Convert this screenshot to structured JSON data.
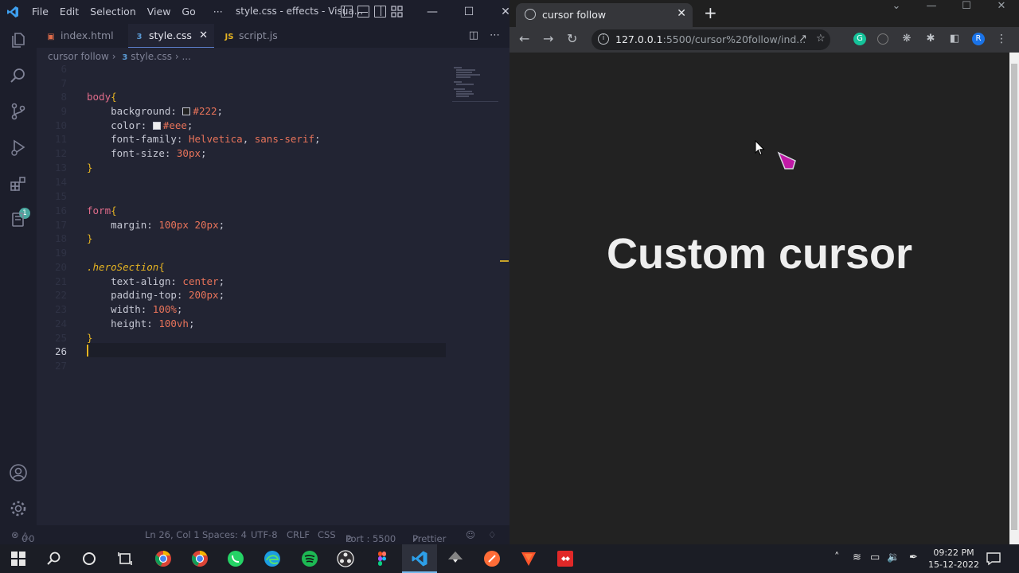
{
  "vscode": {
    "menu": [
      "File",
      "Edit",
      "Selection",
      "View",
      "Go",
      "···"
    ],
    "window_title": "style.css - effects - Visua...",
    "tabs": [
      {
        "label": "index.html",
        "icon": "html-file-icon",
        "active": false
      },
      {
        "label": "style.css",
        "icon": "css-file-icon",
        "active": true
      },
      {
        "label": "script.js",
        "icon": "js-file-icon",
        "active": false
      }
    ],
    "breadcrumb": {
      "folder": "cursor follow",
      "file": "style.css",
      "rest": "..."
    },
    "current_line": "26",
    "activity_badge": "1",
    "status": {
      "errors": "0",
      "warnings": "0",
      "position": "Ln 26, Col 1",
      "spaces": "Spaces: 4",
      "encoding": "UTF-8",
      "eol": "CRLF",
      "language": "CSS",
      "port": "Port : 5500",
      "formatter": "Prettier"
    }
  },
  "chrome": {
    "tab_title": "cursor follow",
    "url_host": "127.0.0.1",
    "url_rest": ":5500/cursor%20follow/ind...",
    "profile_initial": "R",
    "page_heading": "Custom cursor"
  },
  "taskbar": {
    "time": "09:22 PM",
    "date": "15-12-2022"
  },
  "colors": {
    "editor_bg": "#222433",
    "selector": "#e06c8a",
    "value": "#e8735a",
    "brace": "#e6b422",
    "page_bg": "#222222",
    "cursor_pink": "#c01aa6"
  }
}
